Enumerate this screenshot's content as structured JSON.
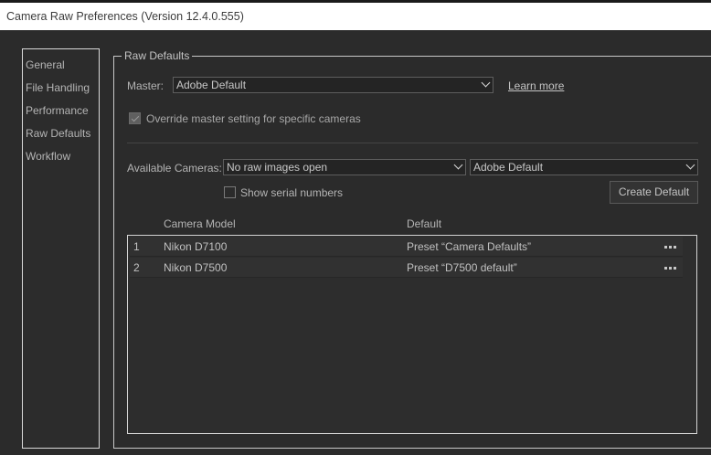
{
  "window": {
    "title": "Camera Raw Preferences  (Version 12.4.0.555)"
  },
  "sidebar": {
    "items": [
      {
        "label": "General"
      },
      {
        "label": "File Handling"
      },
      {
        "label": "Performance"
      },
      {
        "label": "Raw Defaults"
      },
      {
        "label": "Workflow"
      }
    ]
  },
  "raw_defaults": {
    "legend": "Raw Defaults",
    "master_label": "Master:",
    "master_value": "Adobe Default",
    "learn_more": "Learn more",
    "override": {
      "label": "Override master setting for specific cameras",
      "checked": true,
      "enabled": false
    },
    "available_cameras_label": "Available Cameras:",
    "available_cameras_value": "No raw images open",
    "camera_default_value": "Adobe Default",
    "show_serial": {
      "label": "Show serial numbers",
      "checked": false
    },
    "create_default": "Create Default",
    "table": {
      "headers": {
        "model": "Camera Model",
        "default": "Default"
      },
      "rows": [
        {
          "index": "1",
          "model": "Nikon D7100",
          "default": "Preset “Camera Defaults”"
        },
        {
          "index": "2",
          "model": "Nikon D7500",
          "default": "Preset “D7500 default”"
        }
      ]
    }
  },
  "colors": {
    "background": "#2b2b2b",
    "titlebar": "#ffffff",
    "border": "#d9d9d9",
    "text": "#bdbdbd"
  }
}
